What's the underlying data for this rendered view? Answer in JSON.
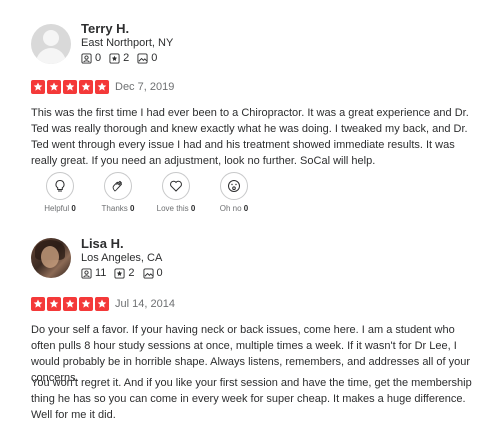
{
  "reviews": [
    {
      "name": "Terry H.",
      "location": "East Northport, NY",
      "friends": "0",
      "reviews": "2",
      "photos": "0",
      "rating": 5,
      "date": "Dec 7, 2019",
      "text": "This was the first time I had ever been to a Chiropractor. It was a great experience and Dr. Ted was really thorough and knew exactly what he was doing. I tweaked my back, and Dr. Ted went through every issue I had and his treatment showed immediate results. It was really great. If you need an adjustment, look no further. SoCal will help.",
      "reactions": [
        {
          "label": "Helpful",
          "count": "0",
          "icon": "lightbulb-icon"
        },
        {
          "label": "Thanks",
          "count": "0",
          "icon": "clap-icon"
        },
        {
          "label": "Love this",
          "count": "0",
          "icon": "heart-icon"
        },
        {
          "label": "Oh no",
          "count": "0",
          "icon": "surprised-face-icon"
        }
      ]
    },
    {
      "name": "Lisa H.",
      "location": "Los Angeles, CA",
      "friends": "11",
      "reviews": "2",
      "photos": "0",
      "rating": 5,
      "date": "Jul 14, 2014",
      "text": "Do your self a favor. If your having neck or back issues, come here. I am a student who often pulls 8 hour study sessions at once, multiple times a week. If it wasn't for Dr Lee, I would probably be in horrible shape. Always listens, remembers, and addresses all of your concerns.",
      "text2": "You won't regret it. And if you like your first session and have the time, get the membership thing he has so you can come in every week for super cheap. It makes a huge difference. Well for me it did."
    }
  ],
  "colors": {
    "star": "#f43939",
    "text": "#2d2e2f",
    "muted": "#6e7072"
  }
}
